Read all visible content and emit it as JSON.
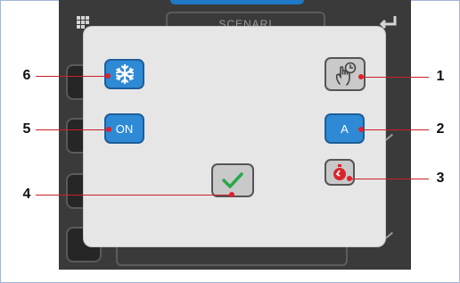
{
  "header": {
    "title": "SCENARI"
  },
  "popup_buttons": {
    "antifreeze_icon": "snowflake-icon",
    "on_label": "ON",
    "confirm_icon": "checkmark-icon",
    "timer_manual_icon": "hand-timer-icon",
    "auto_label": "A",
    "countdown_icon": "stopwatch-icon"
  },
  "callouts": [
    "1",
    "2",
    "3",
    "4",
    "5",
    "6"
  ],
  "colors": {
    "accent_blue": "#2f8ad6",
    "callout_red": "#e0202c",
    "confirm_green": "#2aa84a",
    "popup_bg": "#e6e6e6",
    "device_bg": "#3a3a3a"
  }
}
